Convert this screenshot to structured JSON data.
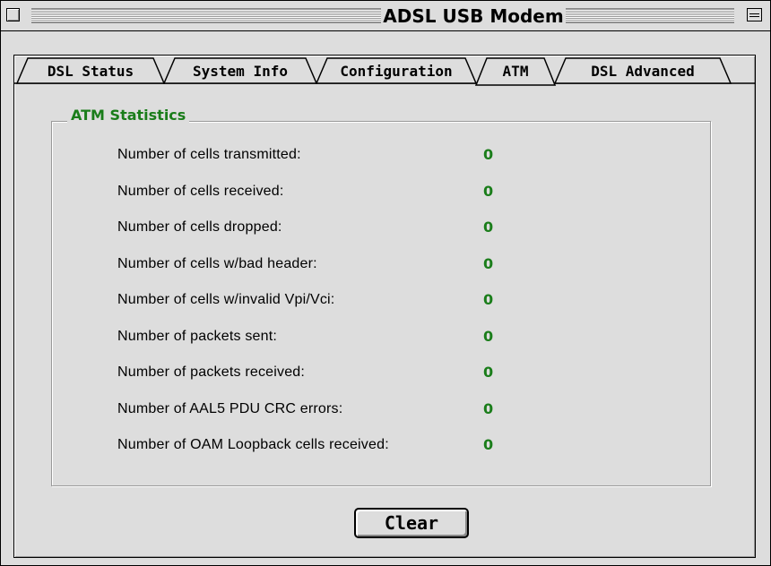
{
  "window": {
    "title": "ADSL USB Modem"
  },
  "tabs": [
    {
      "label": "DSL Status",
      "active": false
    },
    {
      "label": "System Info",
      "active": false
    },
    {
      "label": "Configuration",
      "active": false
    },
    {
      "label": "ATM",
      "active": true
    },
    {
      "label": "DSL Advanced",
      "active": false
    }
  ],
  "group": {
    "title": "ATM Statistics"
  },
  "stats": [
    {
      "label": "Number of cells transmitted:",
      "value": "0"
    },
    {
      "label": "Number of cells received:",
      "value": "0"
    },
    {
      "label": "Number of cells dropped:",
      "value": "0"
    },
    {
      "label": "Number of cells w/bad header:",
      "value": "0"
    },
    {
      "label": "Number of cells w/invalid Vpi/Vci:",
      "value": "0"
    },
    {
      "label": "Number of packets sent:",
      "value": "0"
    },
    {
      "label": "Number of packets received:",
      "value": "0"
    },
    {
      "label": "Number of AAL5 PDU CRC errors:",
      "value": "0"
    },
    {
      "label": "Number of OAM Loopback cells received:",
      "value": "0"
    }
  ],
  "buttons": {
    "clear_label": "Clear"
  },
  "colors": {
    "value_green": "#1a7d1a",
    "window_gray": "#dddddd"
  }
}
